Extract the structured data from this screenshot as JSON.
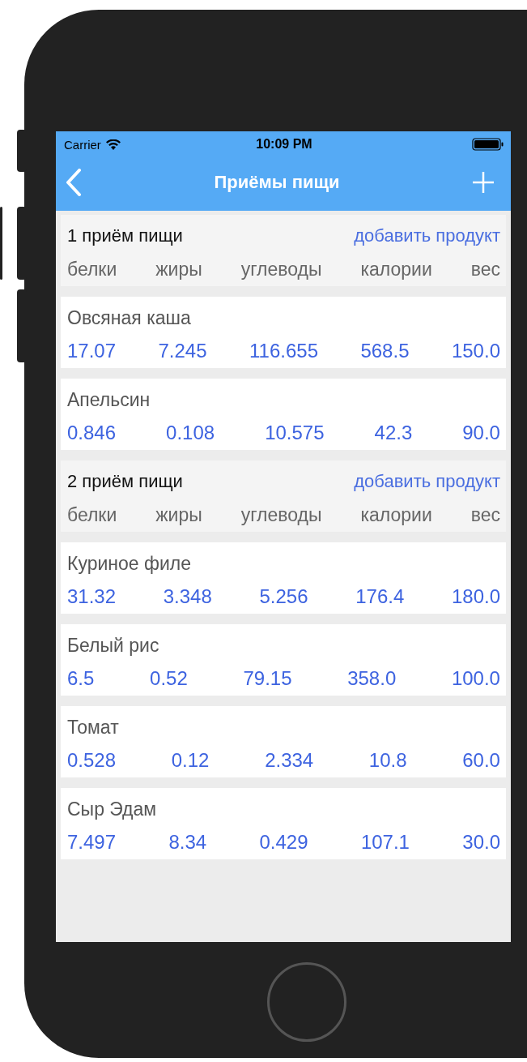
{
  "status_bar": {
    "carrier": "Carrier",
    "time": "10:09 PM"
  },
  "nav_bar": {
    "title": "Приёмы пищи"
  },
  "meals": [
    {
      "title": "1 приём пищи",
      "add_link": "добавить продукт",
      "columns": [
        "белки",
        "жиры",
        "углеводы",
        "калории",
        "вес"
      ],
      "products": [
        {
          "name": "Овсяная каша",
          "values": [
            "17.07",
            "7.245",
            "116.655",
            "568.5",
            "150.0"
          ]
        },
        {
          "name": "Апельсин",
          "values": [
            "0.846",
            "0.108",
            "10.575",
            "42.3",
            "90.0"
          ]
        }
      ]
    },
    {
      "title": "2 приём пищи",
      "add_link": "добавить продукт",
      "columns": [
        "белки",
        "жиры",
        "углеводы",
        "калории",
        "вес"
      ],
      "products": [
        {
          "name": "Куриное филе",
          "values": [
            "31.32",
            "3.348",
            "5.256",
            "176.4",
            "180.0"
          ]
        },
        {
          "name": "Белый рис",
          "values": [
            "6.5",
            "0.52",
            "79.15",
            "358.0",
            "100.0"
          ]
        },
        {
          "name": "Томат",
          "values": [
            "0.528",
            "0.12",
            "2.334",
            "10.8",
            "60.0"
          ]
        },
        {
          "name": "Сыр Эдам",
          "values": [
            "7.497",
            "8.34",
            "0.429",
            "107.1",
            "30.0"
          ]
        }
      ]
    }
  ]
}
